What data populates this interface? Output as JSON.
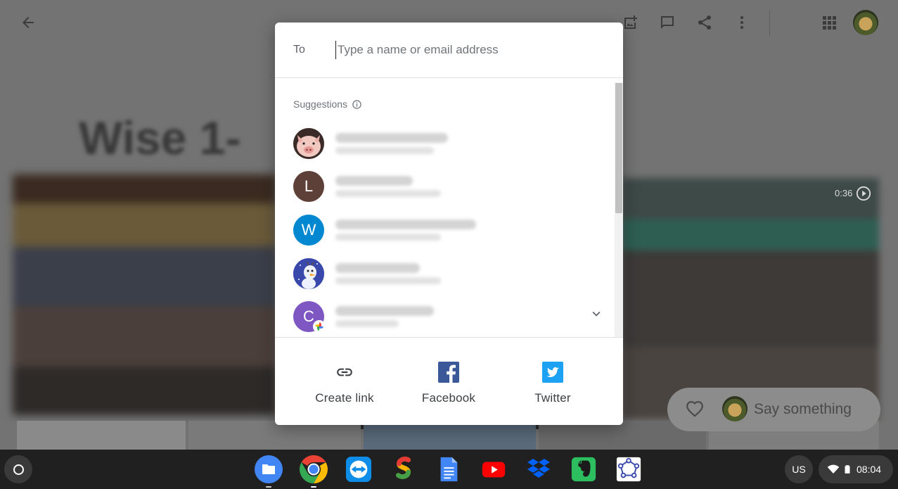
{
  "background": {
    "album_title": "Wise 1-",
    "video_duration": "0:36",
    "comment_placeholder": "Say something"
  },
  "dialog": {
    "to_label": "To",
    "to_placeholder": "Type a name or email address",
    "suggestions_label": "Suggestions",
    "contacts": [
      {
        "initial": "",
        "avatar": "pig-photo",
        "color": "#e9c9c0"
      },
      {
        "initial": "L",
        "avatar": "letter",
        "color": "#5d4037"
      },
      {
        "initial": "W",
        "avatar": "letter",
        "color": "#0288d1"
      },
      {
        "initial": "",
        "avatar": "snowman-photo",
        "color": "#5c6bc0"
      },
      {
        "initial": "C",
        "avatar": "letter",
        "color": "#7e57c2"
      }
    ],
    "actions": [
      {
        "label": "Create link",
        "icon": "link-icon"
      },
      {
        "label": "Facebook",
        "icon": "facebook-icon",
        "color": "#3b5998"
      },
      {
        "label": "Twitter",
        "icon": "twitter-icon",
        "color": "#1da1f2"
      }
    ]
  },
  "shelf": {
    "apps": [
      "files-icon",
      "chrome-icon",
      "teamviewer-icon",
      "sketchbook-icon",
      "docs-icon",
      "youtube-icon",
      "dropbox-icon",
      "evernote-icon",
      "graph-app-icon"
    ],
    "ime": "US",
    "time": "08:04"
  }
}
